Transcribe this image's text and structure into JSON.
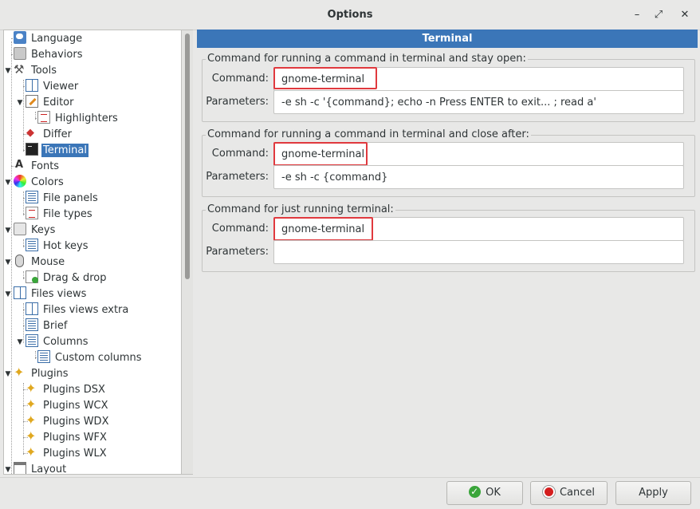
{
  "window": {
    "title": "Options",
    "minimize_glyph": "–",
    "maximize_glyph": "⤢",
    "close_glyph": "✕"
  },
  "tree": {
    "items": [
      {
        "label": "Language",
        "icon": "language-icon"
      },
      {
        "label": "Behaviors",
        "icon": "behaviors-icon"
      },
      {
        "label": "Tools",
        "icon": "tools-icon",
        "expanded": true
      },
      {
        "label": "Viewer",
        "icon": "viewer-icon"
      },
      {
        "label": "Editor",
        "icon": "editor-icon",
        "expanded": true
      },
      {
        "label": "Highlighters",
        "icon": "highlighters-icon"
      },
      {
        "label": "Differ",
        "icon": "differ-icon"
      },
      {
        "label": "Terminal",
        "icon": "terminal-icon",
        "selected": true
      },
      {
        "label": "Fonts",
        "icon": "fonts-icon"
      },
      {
        "label": "Colors",
        "icon": "colors-icon",
        "expanded": true
      },
      {
        "label": "File panels",
        "icon": "file-panels-icon"
      },
      {
        "label": "File types",
        "icon": "file-types-icon"
      },
      {
        "label": "Keys",
        "icon": "keys-icon",
        "expanded": true
      },
      {
        "label": "Hot keys",
        "icon": "hot-keys-icon"
      },
      {
        "label": "Mouse",
        "icon": "mouse-icon",
        "expanded": true
      },
      {
        "label": "Drag & drop",
        "icon": "drag-drop-icon"
      },
      {
        "label": "Files views",
        "icon": "files-views-icon",
        "expanded": true
      },
      {
        "label": "Files views extra",
        "icon": "files-views-extra-icon"
      },
      {
        "label": "Brief",
        "icon": "brief-icon"
      },
      {
        "label": "Columns",
        "icon": "columns-icon",
        "expanded": true
      },
      {
        "label": "Custom columns",
        "icon": "custom-columns-icon"
      },
      {
        "label": "Plugins",
        "icon": "plugins-icon",
        "expanded": true
      },
      {
        "label": "Plugins DSX",
        "icon": "plugin-icon"
      },
      {
        "label": "Plugins WCX",
        "icon": "plugin-icon"
      },
      {
        "label": "Plugins WDX",
        "icon": "plugin-icon"
      },
      {
        "label": "Plugins WFX",
        "icon": "plugin-icon"
      },
      {
        "label": "Plugins WLX",
        "icon": "plugin-icon"
      },
      {
        "label": "Layout",
        "icon": "layout-icon",
        "expanded": true
      }
    ]
  },
  "panel": {
    "title": "Terminal",
    "groups": [
      {
        "label": "Command for running a command in terminal and stay open:",
        "command_label": "Command:",
        "command": "gnome-terminal",
        "parameters_label": "Parameters:",
        "parameters": "-e sh -c '{command}; echo -n Press ENTER to exit... ; read a'"
      },
      {
        "label": "Command for running a command in terminal and close after:",
        "command_label": "Command:",
        "command": "gnome-terminal",
        "parameters_label": "Parameters:",
        "parameters": "-e sh -c {command}"
      },
      {
        "label": "Command for just running terminal:",
        "command_label": "Command:",
        "command": "gnome-terminal",
        "parameters_label": "Parameters:",
        "parameters": ""
      }
    ]
  },
  "buttons": {
    "ok": "OK",
    "cancel": "Cancel",
    "apply": "Apply"
  },
  "colors": {
    "accent": "#3b76b8",
    "highlight_box": "#e0393e"
  }
}
